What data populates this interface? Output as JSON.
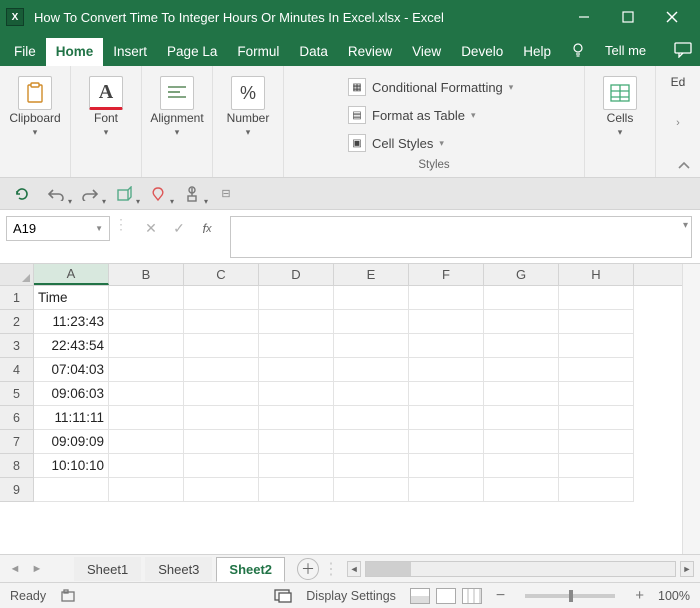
{
  "title": "How To Convert Time To Integer Hours Or Minutes In Excel.xlsx  -  Excel",
  "tabs": [
    "File",
    "Home",
    "Insert",
    "Page La",
    "Formul",
    "Data",
    "Review",
    "View",
    "Develo",
    "Help"
  ],
  "active_tab": "Home",
  "tellme": "Tell me",
  "ribbon": {
    "clipboard": {
      "label": "Clipboard"
    },
    "font": {
      "label": "Font"
    },
    "alignment": {
      "label": "Alignment"
    },
    "number": {
      "label": "Number"
    },
    "styles": {
      "label": "Styles",
      "conditional": "Conditional Formatting",
      "table": "Format as Table",
      "cellstyles": "Cell Styles"
    },
    "cells": {
      "label": "Cells"
    },
    "editing": {
      "label": "Ed"
    }
  },
  "namebox": "A19",
  "columns": [
    "A",
    "B",
    "C",
    "D",
    "E",
    "F",
    "G",
    "H"
  ],
  "rows": [
    1,
    2,
    3,
    4,
    5,
    6,
    7,
    8,
    9
  ],
  "cells": {
    "A1": "Time",
    "A2": "11:23:43",
    "A3": "22:43:54",
    "A4": "07:04:03",
    "A5": "09:06:03",
    "A6": "11:11:11",
    "A7": "09:09:09",
    "A8": "10:10:10"
  },
  "sheets": [
    "Sheet1",
    "Sheet3",
    "Sheet2"
  ],
  "active_sheet": "Sheet2",
  "status": {
    "ready": "Ready",
    "display": "Display Settings",
    "zoom": "100%"
  }
}
